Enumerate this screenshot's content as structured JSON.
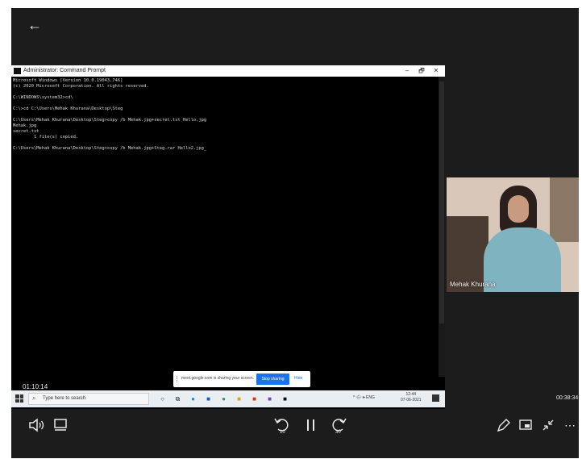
{
  "window": {
    "title": "Administrator: Command Prompt",
    "minimize": "–",
    "restore": "🗗",
    "close": "✕"
  },
  "console_lines": [
    "Microsoft Windows [Version 10.0.19043.746]",
    "(c) 2020 Microsoft Corporation. All rights reserved.",
    "",
    "C:\\WINDOWS\\system32>cd\\",
    "",
    "C:\\>cd C:\\Users\\Mehak Khurana\\Desktop\\Steg",
    "",
    "C:\\Users\\Mehak Khurana\\Desktop\\Steg>copy /b Mehak.jpg+secret.txt Hello.jpg",
    "Mehak.jpg",
    "secret.txt",
    "        1 file(s) copied.",
    "",
    "C:\\Users\\Mehak Khurana\\Desktop\\Steg>copy /b Mehak.jpg+Steg.rar Hello2.jpg_"
  ],
  "share_banner": {
    "message": "meet.google.com is sharing your screen.",
    "stop_label": "Stop sharing",
    "hide_label": "Hide"
  },
  "taskbar": {
    "search_placeholder": "Type here to search",
    "tray_text": "^ 🌧 🕪 ENG",
    "time": "12:44",
    "date": "07-06-2021",
    "apps": [
      {
        "icon": "cortana-icon",
        "glyph": "○",
        "color": "#333333"
      },
      {
        "icon": "task-view-icon",
        "glyph": "⧉",
        "color": "#333333"
      },
      {
        "icon": "edge-icon",
        "glyph": "●",
        "color": "#1f8ad6"
      },
      {
        "icon": "mail-icon",
        "glyph": "■",
        "color": "#1560b8"
      },
      {
        "icon": "chrome-icon",
        "glyph": "●",
        "color": "#2e9b4c"
      },
      {
        "icon": "store-icon",
        "glyph": "■",
        "color": "#e0a21b"
      },
      {
        "icon": "office-icon",
        "glyph": "■",
        "color": "#d83b01"
      },
      {
        "icon": "photos-icon",
        "glyph": "■",
        "color": "#7b3fb0"
      },
      {
        "icon": "terminal-icon",
        "glyph": "■",
        "color": "#111111"
      }
    ]
  },
  "participant": {
    "name": "Mehak Khurana"
  },
  "player": {
    "elapsed": "01:10:14",
    "duration": "00:38:34",
    "icons": {
      "back": "arrow-left-icon",
      "volume": "volume-icon",
      "captions": "captions-icon",
      "rewind": "rewind-10-icon",
      "pause": "pause-icon",
      "forward": "forward-30-icon",
      "edit": "pen-icon",
      "pip": "picture-in-picture-icon",
      "collapse": "exit-fullscreen-icon",
      "more": "more-icon"
    },
    "rewind_seconds": "10",
    "forward_seconds": "30"
  },
  "colors": {
    "player_bg": "#1c1c1c",
    "share_button": "#1a73e8",
    "taskbar": "#e9eef3"
  }
}
